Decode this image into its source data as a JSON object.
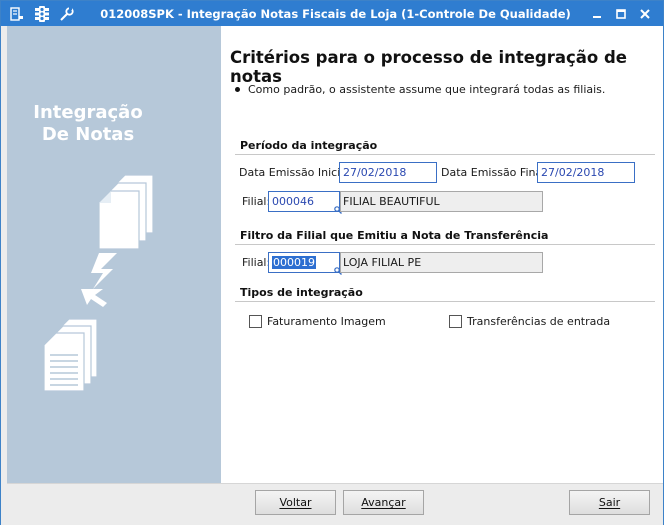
{
  "window": {
    "title": "012008SPK - Integração Notas Fiscais de Loja (1-Controle De Qualidade)",
    "toolbar_icons": [
      "menu-icon",
      "traffic-light-icon",
      "wrench-icon"
    ],
    "controls": [
      "minimize-icon",
      "maximize-icon",
      "close-icon"
    ],
    "accent_color": "#2f7dd0"
  },
  "sidebar": {
    "title_line1": "Integração",
    "title_line2": "De Notas",
    "background_color": "#b6c8d9"
  },
  "main": {
    "heading": "Critérios para o processo de integração de notas",
    "note": "Como padrão, o assistente assume que integrará todas as filiais.",
    "periodo": {
      "title": "Período da integração",
      "data_inicial_label": "Data Emissão Inicial:",
      "data_inicial_value": "27/02/2018",
      "data_final_label": "Data Emissão Final:",
      "data_final_value": "27/02/2018",
      "filial_label": "Filial:",
      "filial_code": "000046",
      "filial_name": "FILIAL BEAUTIFUL"
    },
    "filtro": {
      "title": "Filtro da Filial que Emitiu a Nota de Transferência",
      "filial_label": "Filial:",
      "filial_code": "000019",
      "filial_name": "LOJA FILIAL PE"
    },
    "tipos": {
      "title": "Tipos de integração",
      "faturamento_label": "Faturamento Imagem",
      "faturamento_checked": false,
      "transferencias_label": "Transferências de entrada",
      "transferencias_checked": false
    }
  },
  "buttons": {
    "voltar": "Voltar",
    "avancar": "Avançar",
    "sair": "Sair"
  }
}
